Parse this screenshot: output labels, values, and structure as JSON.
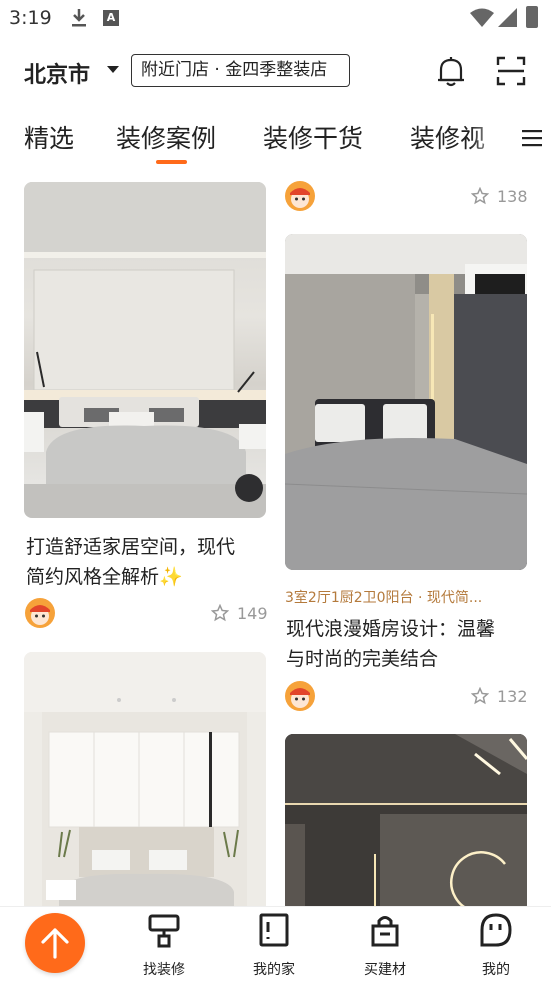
{
  "status_bar": {
    "time": "3:19"
  },
  "header": {
    "city": "北京市",
    "store": "附近门店 · 金四季整装店"
  },
  "tabs": [
    {
      "label": "精选"
    },
    {
      "label": "装修案例"
    },
    {
      "label": "装修干货"
    },
    {
      "label": "装修视"
    }
  ],
  "feed": {
    "left": [
      {
        "title_line1": "打造舒适家居空间，现代",
        "title_line2": "简约风格全解析✨",
        "likes": "149"
      }
    ],
    "right": [
      {
        "likes": "138"
      },
      {
        "meta": "3室2厅1厨2卫0阳台 · 现代简...",
        "title_line1": "现代浪漫婚房设计：温馨",
        "title_line2": "与时尚的完美结合",
        "likes": "132"
      }
    ]
  },
  "bottom_nav": [
    {
      "label": "找装修"
    },
    {
      "label": "我的家"
    },
    {
      "label": "买建材"
    },
    {
      "label": "我的"
    }
  ],
  "colors": {
    "accent": "#ff6a1a",
    "meta": "#b47a3c"
  }
}
